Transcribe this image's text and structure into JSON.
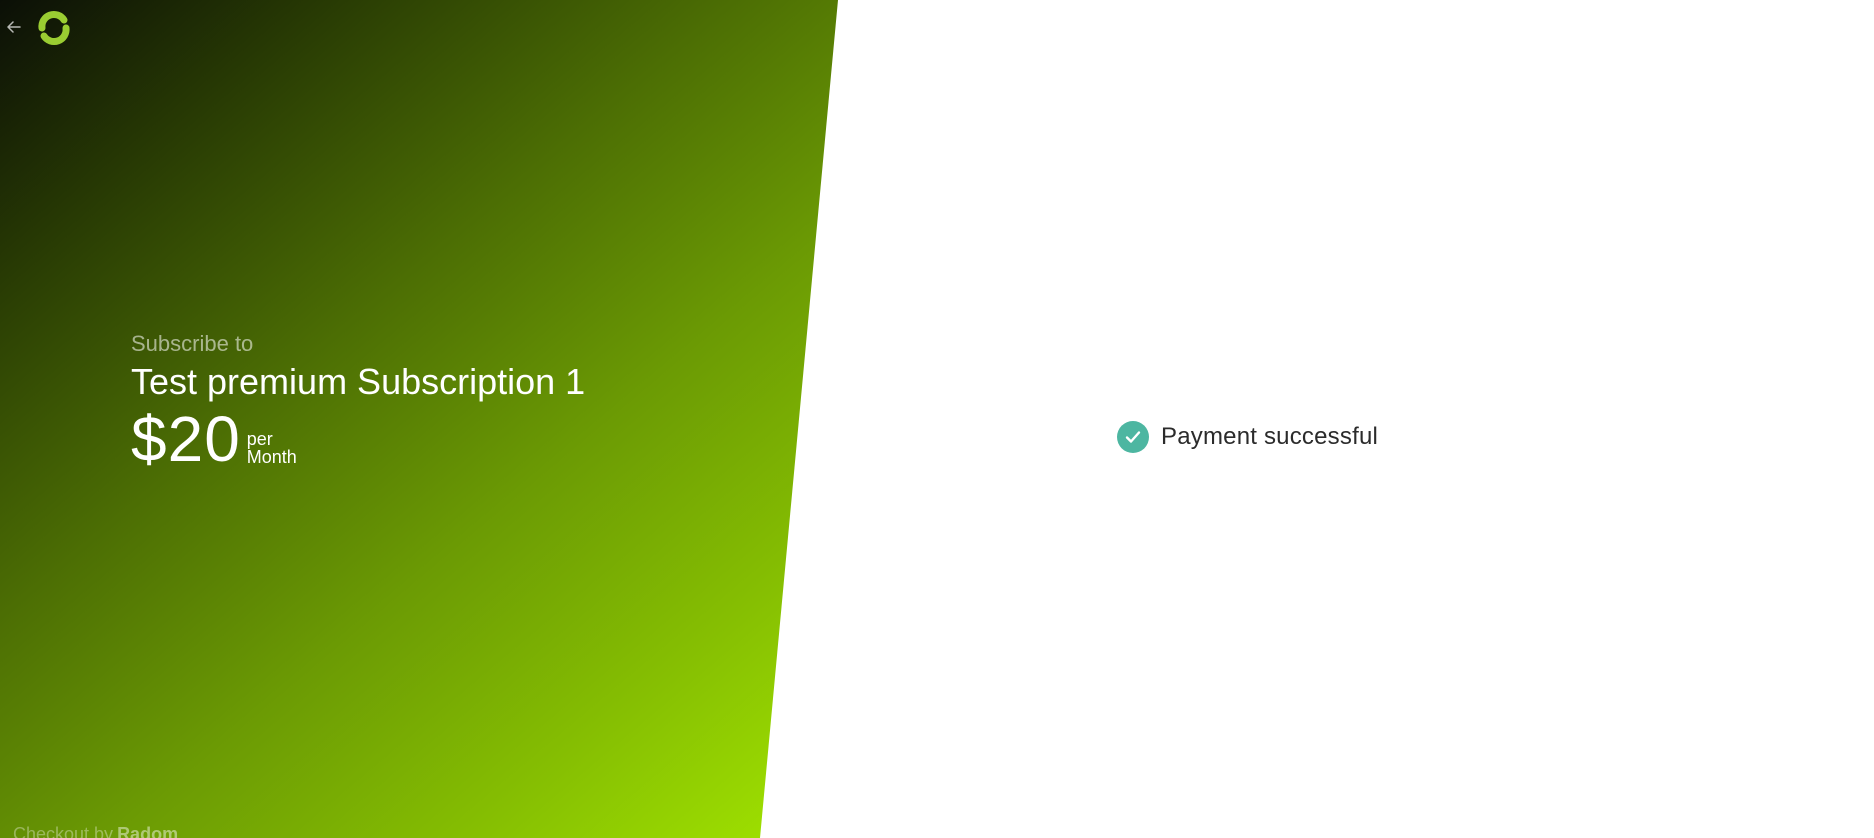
{
  "header": {
    "back_icon": "arrow-left-icon",
    "logo_icon": "radom-logo-icon",
    "logo_color": "#9acd32"
  },
  "product": {
    "subscribe_label": "Subscribe to",
    "name": "Test premium Subscription 1",
    "price": "$20",
    "period_prefix": "per",
    "period_unit": "Month"
  },
  "footer": {
    "prefix": "Checkout by",
    "brand": "Radom"
  },
  "status": {
    "icon": "check-circle-icon",
    "icon_color": "#4db6a1",
    "text": "Payment successful"
  },
  "colors": {
    "gradient_start": "#0b0f06",
    "gradient_end": "#a3e600",
    "background": "#ffffff"
  }
}
